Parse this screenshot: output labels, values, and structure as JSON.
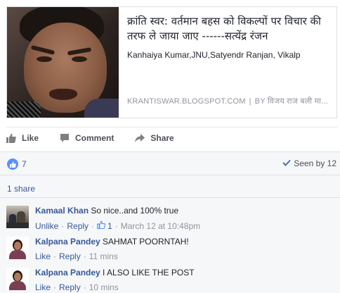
{
  "link_preview": {
    "title": "क्रांति स्वर: वर्तमान बहस को विकल्पों पर विचार की तरफ ले जाया जाए ------सत्येंद्र रंजन",
    "description": "Kanhaiya Kumar,JNU,Satyendr Ranjan, Vikalp",
    "source_domain": "KRANTISWAR.BLOGSPOT.COM",
    "source_separator": "|",
    "source_author": "BY विजय राज बली मा..."
  },
  "actions": {
    "like": "Like",
    "comment": "Comment",
    "share": "Share"
  },
  "stats": {
    "likes_count": "7",
    "seen_by": "Seen by 12",
    "shares": "1 share"
  },
  "comments": [
    {
      "author": "Kamaal Khan",
      "text": "So nice..and 100% true",
      "actions": [
        "Unlike",
        "Reply"
      ],
      "likes": "1",
      "timestamp": "March 12 at 10:48pm"
    },
    {
      "author": "Kalpana Pandey",
      "text": "SAHMAT POORNTAH!",
      "actions": [
        "Like",
        "Reply"
      ],
      "timestamp": "11 mins"
    },
    {
      "author": "Kalpana Pandey",
      "text": "I ALSO LIKE THE POST",
      "actions": [
        "Like",
        "Reply"
      ],
      "timestamp": "10 mins"
    }
  ],
  "colors": {
    "link_blue": "#365899",
    "like_badge_blue": "#5890ff",
    "meta_grey": "#90949c",
    "panel_bg": "#f6f7f9"
  },
  "icons": {
    "like": "thumbs-up-icon",
    "comment": "speech-bubble-icon",
    "share": "share-arrow-icon",
    "seen": "checkmark-icon"
  }
}
